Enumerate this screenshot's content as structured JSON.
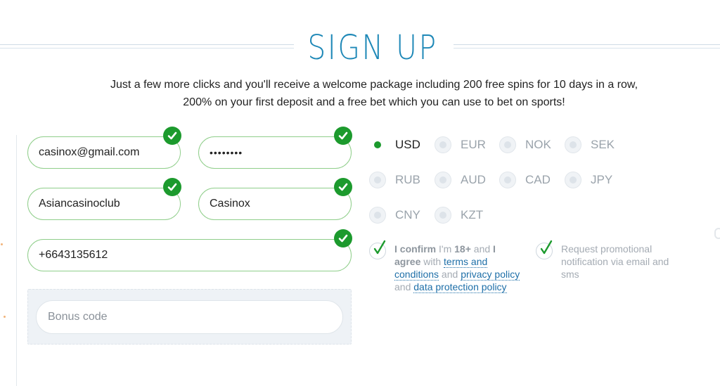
{
  "header": {
    "title": "SIGN UP",
    "subtitle": "Just a few more clicks and you'll receive a welcome package including 200 free spins for 10 days in a row, 200% on your first deposit and a free bet which you can use to bet on sports!"
  },
  "form": {
    "email": "casinox@gmail.com",
    "password": "••••••••",
    "first_name": "Asiancasinoclub",
    "last_name": "Casinox",
    "phone": "+6643135612",
    "bonus_placeholder": "Bonus code"
  },
  "currencies": [
    {
      "code": "USD",
      "selected": true
    },
    {
      "code": "EUR",
      "selected": false
    },
    {
      "code": "NOK",
      "selected": false
    },
    {
      "code": "SEK",
      "selected": false
    },
    {
      "code": "RUB",
      "selected": false
    },
    {
      "code": "AUD",
      "selected": false
    },
    {
      "code": "CAD",
      "selected": false
    },
    {
      "code": "JPY",
      "selected": false
    },
    {
      "code": "CNY",
      "selected": false
    },
    {
      "code": "KZT",
      "selected": false
    }
  ],
  "agreements": {
    "terms": {
      "p1": "I confirm",
      "p2": " I'm ",
      "p3": "18+",
      "p4": " and ",
      "p5": "I agree",
      "p6": " with ",
      "link_terms": "terms and conditions",
      "p7": " and ",
      "link_privacy": "privacy policy",
      "p8": " and ",
      "link_data": "data protection policy"
    },
    "promo": "Request promotional notification via email and sms"
  },
  "colors": {
    "accent": "#1e88b7",
    "valid_green": "#1c9a2d",
    "field_border": "#8fce8a",
    "link": "#1e6fa8"
  }
}
